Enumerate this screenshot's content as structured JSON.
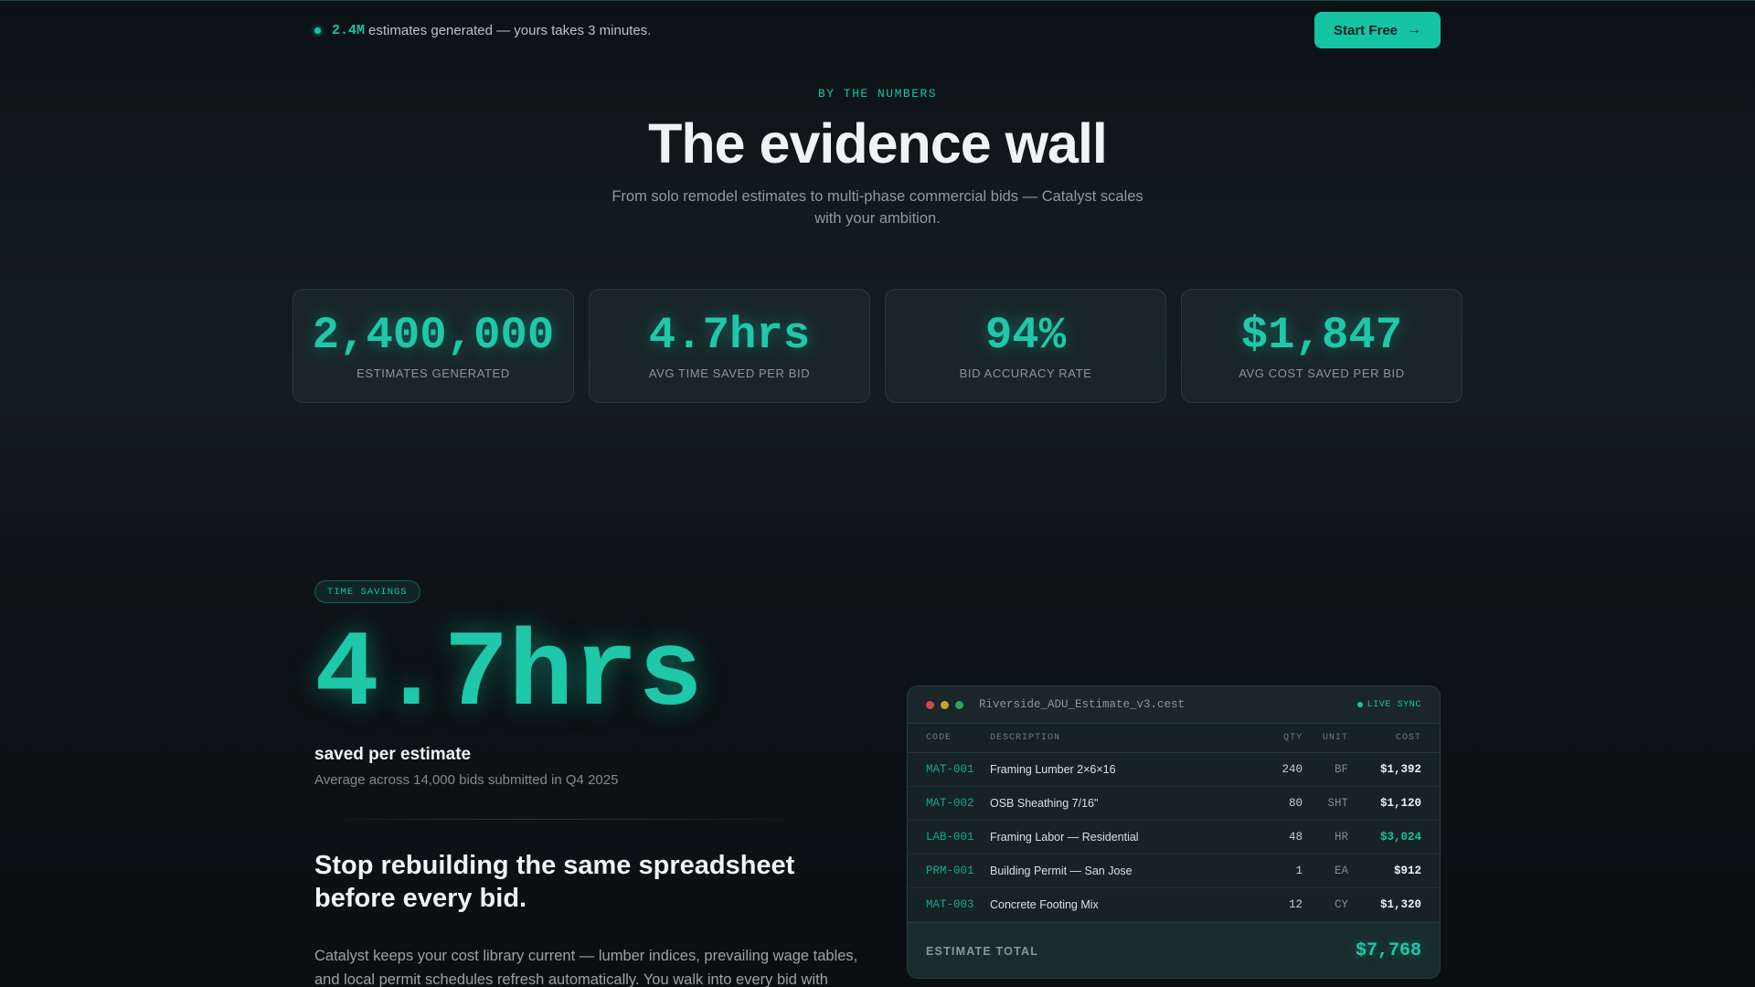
{
  "announcement": {
    "count": "2.4M",
    "text": "estimates generated — yours takes 3 minutes.",
    "cta_label": "Start Free",
    "cta_icon": "arrow-right-icon"
  },
  "hero": {
    "eyebrow": "BY THE NUMBERS",
    "title": "The evidence wall",
    "subtitle": "From solo remodel estimates to multi-phase commercial bids — Catalyst scales with your ambition."
  },
  "stats": [
    {
      "value": "2,400,000",
      "label": "ESTIMATES GENERATED"
    },
    {
      "value": "4.7hrs",
      "label": "AVG TIME SAVED PER BID"
    },
    {
      "value": "94%",
      "label": "BID ACCURACY RATE"
    },
    {
      "value": "$1,847",
      "label": "AVG COST SAVED PER BID"
    }
  ],
  "feature": {
    "pill": "TIME SAVINGS",
    "big_value": "4.7hrs",
    "saved_label": "saved per estimate",
    "average_note": "Average across 14,000 bids submitted in Q4 2025",
    "headline": "Stop rebuilding the same spreadsheet before every bid.",
    "body": "Catalyst keeps your cost library current — lumber indices, prevailing wage tables, and local permit schedules refresh automatically. You walk into every bid with"
  },
  "estimate": {
    "filename": "Riverside_ADU_Estimate_v3.cest",
    "sync_label": "LIVE SYNC",
    "headers": {
      "code": "CODE",
      "description": "DESCRIPTION",
      "qty": "QTY",
      "unit": "UNIT",
      "cost": "COST"
    },
    "rows": [
      {
        "code": "MAT-001",
        "description": "Framing Lumber 2×6×16",
        "qty": "240",
        "unit": "BF",
        "cost": "$1,392"
      },
      {
        "code": "MAT-002",
        "description": "OSB Sheathing 7/16\"",
        "qty": "80",
        "unit": "SHT",
        "cost": "$1,120"
      },
      {
        "code": "LAB-001",
        "description": "Framing Labor — Residential",
        "qty": "48",
        "unit": "HR",
        "cost": "$3,024"
      },
      {
        "code": "PRM-001",
        "description": "Building Permit — San Jose",
        "qty": "1",
        "unit": "EA",
        "cost": "$912"
      },
      {
        "code": "MAT-003",
        "description": "Concrete Footing Mix",
        "qty": "12",
        "unit": "CY",
        "cost": "$1,320"
      }
    ],
    "total_label": "ESTIMATE TOTAL",
    "total_value": "$7,768"
  },
  "colors": {
    "accent": "#14c4a4",
    "background": "#0c1215",
    "card": "#19252a"
  }
}
